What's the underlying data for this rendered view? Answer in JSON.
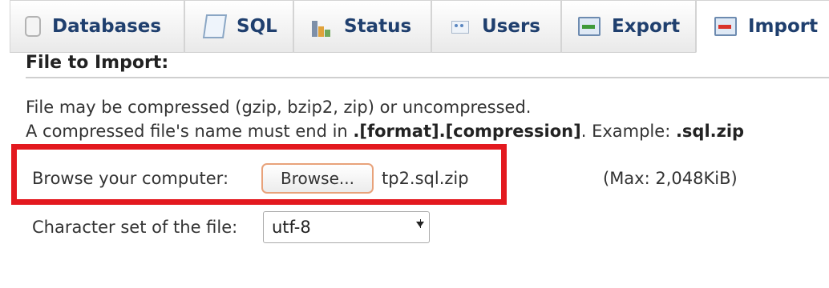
{
  "tabs": [
    {
      "label": "Databases",
      "icon": "database-icon",
      "active": false
    },
    {
      "label": "SQL",
      "icon": "sql-icon",
      "active": false
    },
    {
      "label": "Status",
      "icon": "status-chart-icon",
      "active": false
    },
    {
      "label": "Users",
      "icon": "users-icon",
      "active": false
    },
    {
      "label": "Export",
      "icon": "export-icon",
      "active": false
    },
    {
      "label": "Import",
      "icon": "import-icon",
      "active": true
    }
  ],
  "section": {
    "title": "File to Import:"
  },
  "info": {
    "line1": "File may be compressed (gzip, bzip2, zip) or uncompressed.",
    "line2_prefix": "A compressed file's name must end in ",
    "line2_format": ".[format].[compression]",
    "line2_example_label": ". Example: ",
    "line2_example": ".sql.zip"
  },
  "browse": {
    "label": "Browse your computer:",
    "button_label": "Browse...",
    "filename": "tp2.sql.zip",
    "max": "(Max: 2,048KiB)"
  },
  "charset": {
    "label": "Character set of the file:",
    "value": "utf-8"
  },
  "colors": {
    "tab_text": "#1f3f6e",
    "highlight_border": "#e3191f",
    "browse_button_border": "#e8a27a"
  }
}
